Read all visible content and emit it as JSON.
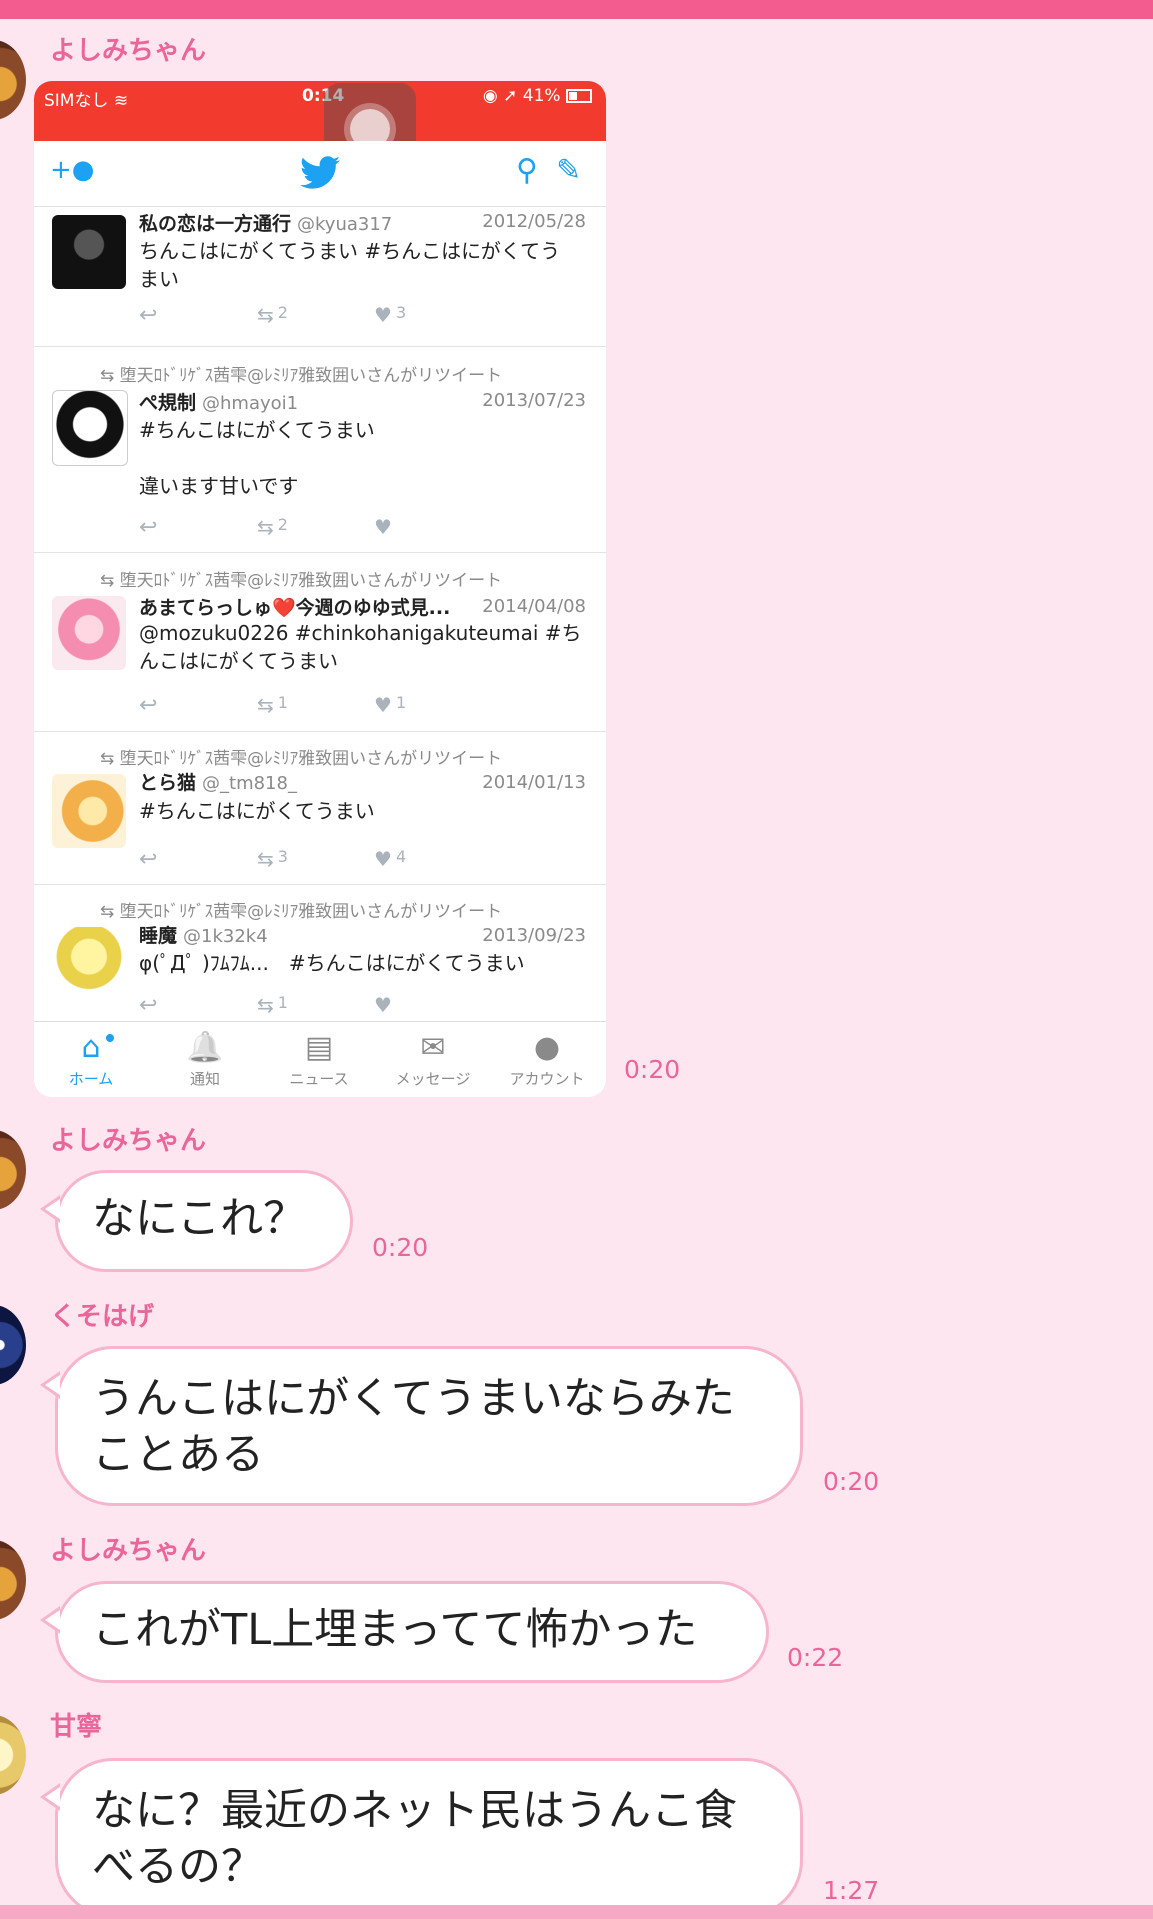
{
  "chat": {
    "messages": [
      {
        "sender": "よしみちゃん",
        "type": "image",
        "time": "0:20"
      },
      {
        "sender": "よしみちゃん",
        "text": "なにこれ？",
        "time": "0:20"
      },
      {
        "sender": "くそはげ",
        "lines": [
          "うんこはにがくてうまいならみた",
          "ことある"
        ],
        "time": "0:20"
      },
      {
        "sender": "よしみちゃん",
        "text": "これがTL上埋まってて怖かった",
        "time": "0:22"
      },
      {
        "sender": "甘寧",
        "lines": [
          "なに？最近のネット民はうんこ食",
          "べるの？"
        ],
        "time": "1:27"
      }
    ]
  },
  "screenshot": {
    "status": {
      "carrier": "SIMなし",
      "time": "0:14",
      "battery": "41%"
    },
    "tweets": [
      {
        "name": "私の恋は一方通行",
        "handle": "@kyua317",
        "date": "2012/05/28",
        "lines": [
          "ちんこはにがくてうまい #ちんこはにがくてう",
          "まい"
        ],
        "retweets": "2",
        "likes": "3"
      },
      {
        "retweeted_by": "堕天ﾛﾄﾞﾘｹﾞｽ茜雫@ﾚﾐﾘｱ雅致囲いさんがリツイート",
        "name": "ぺ規制",
        "handle": "@hmayoi1",
        "date": "2013/07/23",
        "lines": [
          "#ちんこはにがくてうまい",
          "",
          "違います甘いです"
        ],
        "retweets": "2",
        "likes": ""
      },
      {
        "retweeted_by": "堕天ﾛﾄﾞﾘｹﾞｽ茜雫@ﾚﾐﾘｱ雅致囲いさんがリツイート",
        "name": "あまてらっしゅ❤️今週のゆゆ式見...",
        "handle": "",
        "date": "2014/04/08",
        "lines": [
          "@mozuku0226 #chinkohanigakuteumai #ち",
          "んこはにがくてうまい"
        ],
        "retweets": "1",
        "likes": "1"
      },
      {
        "retweeted_by": "堕天ﾛﾄﾞﾘｹﾞｽ茜雫@ﾚﾐﾘｱ雅致囲いさんがリツイート",
        "name": "とら猫",
        "handle": "@_tm818_",
        "date": "2014/01/13",
        "lines": [
          "#ちんこはにがくてうまい"
        ],
        "retweets": "3",
        "likes": "4"
      },
      {
        "retweeted_by": "堕天ﾛﾄﾞﾘｹﾞｽ茜雫@ﾚﾐﾘｱ雅致囲いさんがリツイート",
        "name": "睡魔",
        "handle": "@1k32k4",
        "date": "2013/09/23",
        "lines": [
          "φ(ﾟДﾟ )ﾌﾑﾌﾑ...　#ちんこはにがくてうまい"
        ],
        "retweets": "1",
        "likes": ""
      }
    ],
    "tabs": [
      {
        "label": "ホーム",
        "icon": "home-icon",
        "glyph": "⌂"
      },
      {
        "label": "通知",
        "icon": "bell-icon",
        "glyph": "🔔"
      },
      {
        "label": "ニュース",
        "icon": "news-icon",
        "glyph": "▤"
      },
      {
        "label": "メッセージ",
        "icon": "mail-icon",
        "glyph": "✉"
      },
      {
        "label": "アカウント",
        "icon": "account-icon",
        "glyph": "●"
      }
    ]
  },
  "colors": {
    "background": "#fde6ef",
    "accent": "#e9659a",
    "bubble_border": "#f6b5cd",
    "twitter_blue": "#1da1f2",
    "status_red": "#f23a2e"
  }
}
